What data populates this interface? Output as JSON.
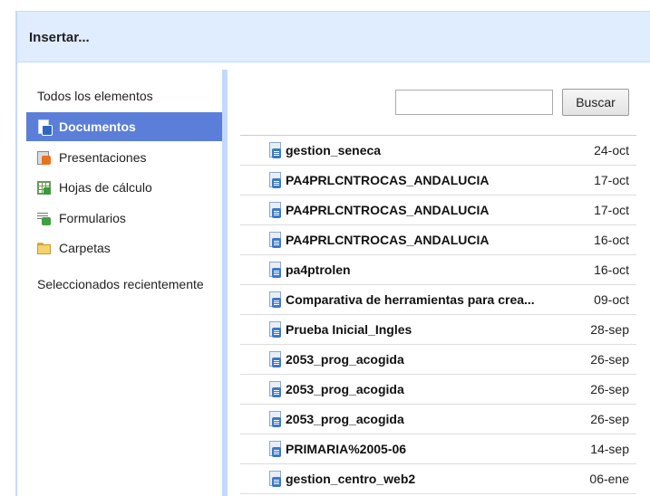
{
  "dialog": {
    "title": "Insertar..."
  },
  "sidebar": {
    "all_label": "Todos los elementos",
    "items": [
      {
        "label": "Documentos",
        "icon": "document-icon",
        "selected": true
      },
      {
        "label": "Presentaciones",
        "icon": "presentation-icon",
        "selected": false
      },
      {
        "label": "Hojas de cálculo",
        "icon": "spreadsheet-icon",
        "selected": false
      },
      {
        "label": "Formularios",
        "icon": "form-icon",
        "selected": false
      },
      {
        "label": "Carpetas",
        "icon": "folder-icon",
        "selected": false
      }
    ],
    "recent_label": "Seleccionados recientemente"
  },
  "search": {
    "value": "",
    "placeholder": "",
    "button_label": "Buscar"
  },
  "files": [
    {
      "name": "gestion_seneca",
      "date": "24-oct"
    },
    {
      "name": "PA4PRLCNTROCAS_ANDALUCIA",
      "date": "17-oct"
    },
    {
      "name": "PA4PRLCNTROCAS_ANDALUCIA",
      "date": "17-oct"
    },
    {
      "name": "PA4PRLCNTROCAS_ANDALUCIA",
      "date": "16-oct"
    },
    {
      "name": "pa4ptrolen",
      "date": "16-oct"
    },
    {
      "name": "Comparativa de herramientas para crea...",
      "date": "09-oct"
    },
    {
      "name": "Prueba Inicial_Ingles",
      "date": "28-sep"
    },
    {
      "name": "2053_prog_acogida",
      "date": "26-sep"
    },
    {
      "name": "2053_prog_acogida",
      "date": "26-sep"
    },
    {
      "name": "2053_prog_acogida",
      "date": "26-sep"
    },
    {
      "name": "PRIMARIA%2005-06",
      "date": "14-sep"
    },
    {
      "name": "gestion_centro_web2",
      "date": "06-ene"
    }
  ],
  "colors": {
    "titlebar": "#e0ecff",
    "selected": "#5b7ed8",
    "divider": "#c3d9ff",
    "doc_badge": "#3c78c8"
  }
}
